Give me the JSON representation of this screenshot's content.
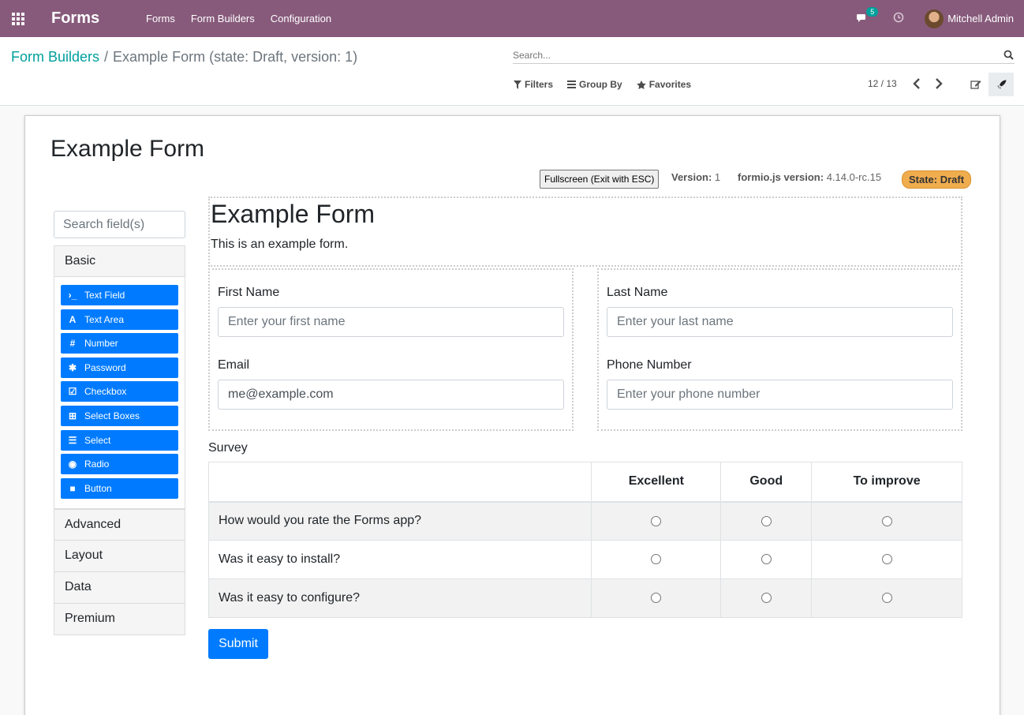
{
  "navbar": {
    "app_title": "Forms",
    "menu": [
      "Forms",
      "Form Builders",
      "Configuration"
    ],
    "messages_count": "5",
    "user_name": "Mitchell Admin"
  },
  "breadcrumb": {
    "parent": "Form Builders",
    "separator": "/",
    "current": "Example Form (state: Draft, version: 1)"
  },
  "search": {
    "placeholder": "Search..."
  },
  "filters": {
    "filters": "Filters",
    "group_by": "Group By",
    "favorites": "Favorites"
  },
  "pager": {
    "value": "12 / 13"
  },
  "sheet": {
    "title": "Example Form",
    "fullscreen_button": "Fullscreen (Exit with ESC)",
    "version_label": "Version:",
    "version_value": "1",
    "formio_label": "formio.js version:",
    "formio_value": "4.14.0-rc.15",
    "state_badge": "State: Draft"
  },
  "builder": {
    "search_placeholder": "Search field(s)",
    "groups": {
      "basic": "Basic",
      "advanced": "Advanced",
      "layout": "Layout",
      "data": "Data",
      "premium": "Premium"
    },
    "basic_components": [
      {
        "label": "Text Field",
        "icon": "terminal-icon",
        "glyph": "›_"
      },
      {
        "label": "Text Area",
        "icon": "font-icon",
        "glyph": "A"
      },
      {
        "label": "Number",
        "icon": "hashtag-icon",
        "glyph": "#"
      },
      {
        "label": "Password",
        "icon": "asterisk-icon",
        "glyph": "✱"
      },
      {
        "label": "Checkbox",
        "icon": "check-square-icon",
        "glyph": "☑"
      },
      {
        "label": "Select Boxes",
        "icon": "plus-square-icon",
        "glyph": "⊞"
      },
      {
        "label": "Select",
        "icon": "th-list-icon",
        "glyph": "☰"
      },
      {
        "label": "Radio",
        "icon": "dot-circle-icon",
        "glyph": "◉"
      },
      {
        "label": "Button",
        "icon": "stop-icon",
        "glyph": "■"
      }
    ]
  },
  "form": {
    "heading": "Example Form",
    "description": "This is an example form.",
    "first_name": {
      "label": "First Name",
      "placeholder": "Enter your first name"
    },
    "last_name": {
      "label": "Last Name",
      "placeholder": "Enter your last name"
    },
    "email": {
      "label": "Email",
      "value": "me@example.com"
    },
    "phone": {
      "label": "Phone Number",
      "placeholder": "Enter your phone number"
    },
    "survey": {
      "label": "Survey",
      "columns": [
        "Excellent",
        "Good",
        "To improve"
      ],
      "questions": [
        "How would you rate the Forms app?",
        "Was it easy to install?",
        "Was it easy to configure?"
      ]
    },
    "submit": "Submit"
  },
  "colors": {
    "navbar": "#875a7b",
    "accent": "#00a09d",
    "primary_button": "#007bff",
    "state_badge": "#f0ad4e"
  }
}
